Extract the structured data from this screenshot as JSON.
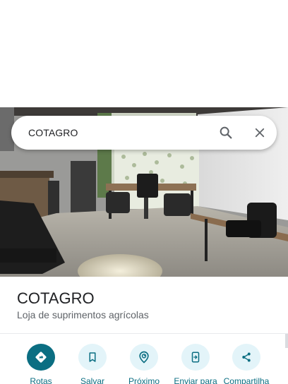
{
  "search": {
    "query": "COTAGRO"
  },
  "place": {
    "name": "COTAGRO",
    "category": "Loja de suprimentos agrícolas"
  },
  "actions": [
    {
      "label": "Rotas",
      "icon": "directions-icon"
    },
    {
      "label": "Salvar",
      "icon": "bookmark-icon"
    },
    {
      "label": "Próximo",
      "icon": "nearby-icon"
    },
    {
      "label": "Enviar para",
      "icon": "send-to-phone-icon"
    },
    {
      "label": "Compartilha",
      "icon": "share-icon"
    }
  ],
  "colors": {
    "accent": "#0b6e82",
    "chip": "#e3f4f9",
    "text": "#202124",
    "muted": "#5f6368"
  }
}
